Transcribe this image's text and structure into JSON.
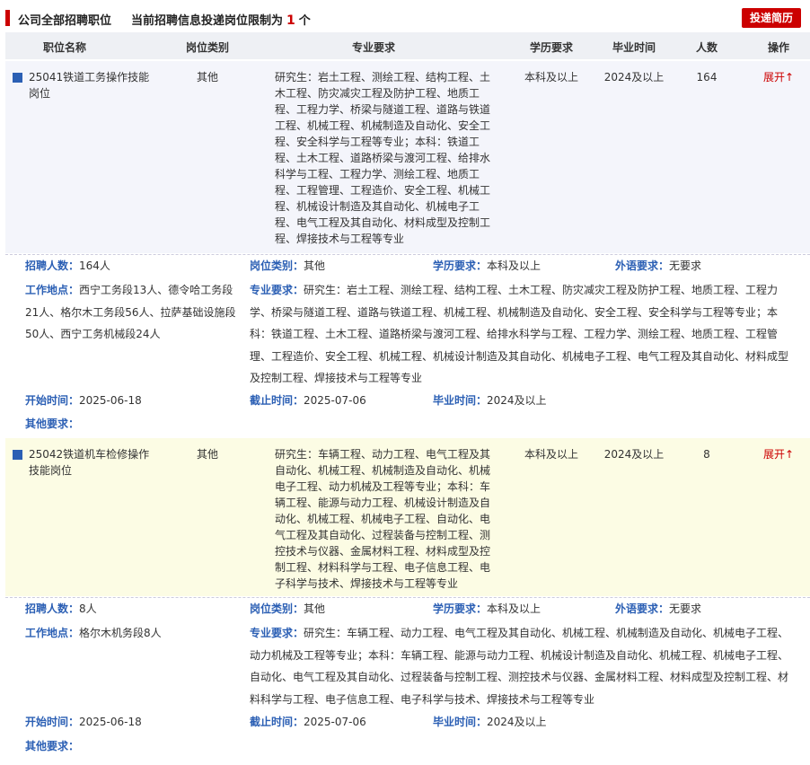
{
  "header": {
    "title": "公司全部招聘职位",
    "limit_prefix": "当前招聘信息投递岗位限制为",
    "limit_num": "1",
    "limit_suffix": "个",
    "submit_label": "投递简历"
  },
  "columns": [
    "职位名称",
    "岗位类别",
    "专业要求",
    "学历要求",
    "毕业时间",
    "人数",
    "操作"
  ],
  "labels": {
    "recruit": "招聘人数：",
    "category": "岗位类别：",
    "education": "学历要求：",
    "language": "外语要求：",
    "location": "工作地点：",
    "major": "专业要求：",
    "start": "开始时间：",
    "end": "截止时间：",
    "grad": "毕业时间：",
    "other": "其他要求："
  },
  "jobs": [
    {
      "name": "25041铁道工务操作技能岗位",
      "category": "其他",
      "major": "研究生：岩土工程、测绘工程、结构工程、土木工程、防灾减灾工程及防护工程、地质工程、工程力学、桥梁与隧道工程、道路与铁道工程、机械工程、机械制造及自动化、安全工程、安全科学与工程等专业；本科：铁道工程、土木工程、道路桥梁与渡河工程、给排水科学与工程、工程力学、测绘工程、地质工程、工程管理、工程造价、安全工程、机械工程、机械设计制造及其自动化、机械电子工程、电气工程及其自动化、材料成型及控制工程、焊接技术与工程等专业",
      "education": "本科及以上",
      "grad": "2024及以上",
      "count": "164",
      "op": "展开↑",
      "detail": {
        "recruit": "164人",
        "category": "其他",
        "education": "本科及以上",
        "language": "无要求",
        "location": "西宁工务段13人、德令哈工务段21人、格尔木工务段56人、拉萨基础设施段50人、西宁工务机械段24人",
        "major": "研究生：岩土工程、测绘工程、结构工程、土木工程、防灾减灾工程及防护工程、地质工程、工程力学、桥梁与隧道工程、道路与铁道工程、机械工程、机械制造及自动化、安全工程、安全科学与工程等专业；本科：铁道工程、土木工程、道路桥梁与渡河工程、给排水科学与工程、工程力学、测绘工程、地质工程、工程管理、工程造价、安全工程、机械工程、机械设计制造及其自动化、机械电子工程、电气工程及其自动化、材料成型及控制工程、焊接技术与工程等专业",
        "start": "2025-06-18",
        "end": "2025-07-06",
        "grad": "2024及以上",
        "other": ""
      }
    },
    {
      "name": "25042铁道机车检修操作技能岗位",
      "category": "其他",
      "major": "研究生：车辆工程、动力工程、电气工程及其自动化、机械工程、机械制造及自动化、机械电子工程、动力机械及工程等专业；本科：车辆工程、能源与动力工程、机械设计制造及自动化、机械工程、机械电子工程、自动化、电气工程及其自动化、过程装备与控制工程、测控技术与仪器、金属材料工程、材料成型及控制工程、材料科学与工程、电子信息工程、电子科学与技术、焊接技术与工程等专业",
      "education": "本科及以上",
      "grad": "2024及以上",
      "count": "8",
      "op": "展开↑",
      "detail": {
        "recruit": "8人",
        "category": "其他",
        "education": "本科及以上",
        "language": "无要求",
        "location": "格尔木机务段8人",
        "major": "研究生：车辆工程、动力工程、电气工程及其自动化、机械工程、机械制造及自动化、机械电子工程、动力机械及工程等专业；本科：车辆工程、能源与动力工程、机械设计制造及自动化、机械工程、机械电子工程、自动化、电气工程及其自动化、过程装备与控制工程、测控技术与仪器、金属材料工程、材料成型及控制工程、材料科学与工程、电子信息工程、电子科学与技术、焊接技术与工程等专业",
        "start": "2025-06-18",
        "end": "2025-07-06",
        "grad": "2024及以上",
        "other": ""
      }
    }
  ]
}
